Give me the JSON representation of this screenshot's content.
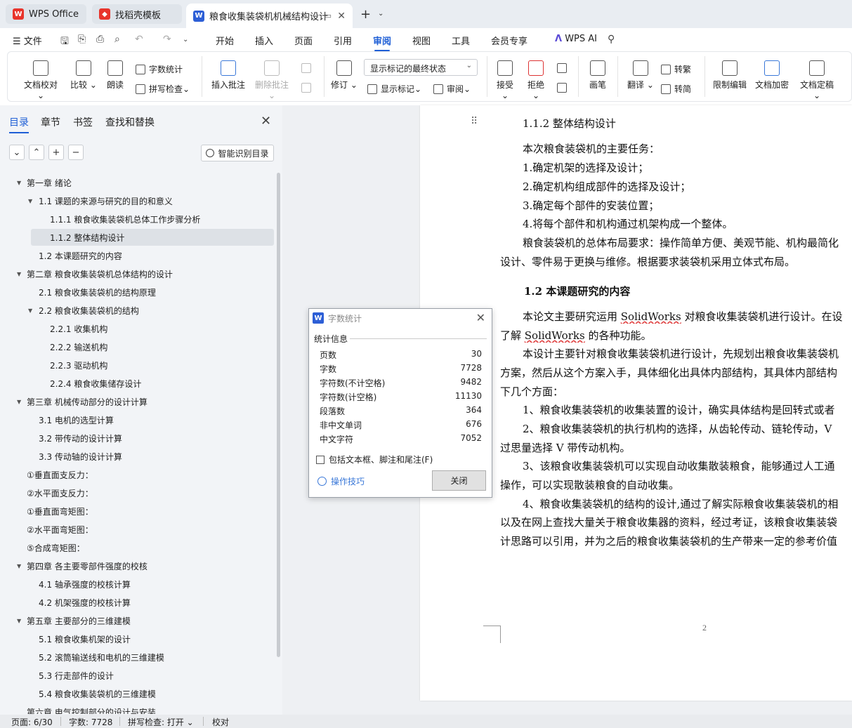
{
  "tabs": [
    {
      "label": "WPS Office",
      "icon": "wps-logo-icon"
    },
    {
      "label": "找稻壳模板",
      "icon": "docer-icon"
    },
    {
      "label": "粮食收集装袋机机械结构设计",
      "icon": "word-doc-icon"
    }
  ],
  "menu": {
    "file": "文件",
    "items": [
      "开始",
      "插入",
      "页面",
      "引用",
      "审阅",
      "视图",
      "工具",
      "会员专享"
    ],
    "active": "审阅",
    "ai": "WPS AI"
  },
  "ribbon": {
    "doc_proofread": "文档校对",
    "compare": "比较",
    "read_aloud": "朗读",
    "word_count": "字数统计",
    "spell_check": "拼写检查",
    "insert_comment": "插入批注",
    "delete_comment": "删除批注",
    "revise": "修订",
    "show_markup_state": "显示标记的最终状态",
    "show_markup": "显示标记",
    "review": "审阅",
    "accept": "接受",
    "reject": "拒绝",
    "pen": "画笔",
    "translate": "翻译",
    "to_traditional": "转繁",
    "to_simplified": "转简",
    "restrict_edit": "限制编辑",
    "encrypt": "文档加密",
    "finalize": "文档定稿"
  },
  "panel": {
    "tabs": [
      "目录",
      "章节",
      "书签",
      "查找和替换"
    ],
    "smart_toc": "智能识别目录",
    "toc": [
      {
        "text": "第一章  绪论",
        "level": 0,
        "toggle": true
      },
      {
        "text": "1.1  课题的来源与研究的目的和意义",
        "level": 1,
        "toggle": true
      },
      {
        "text": "1.1.1  粮食收集装袋机总体工作步骤分析",
        "level": 2,
        "toggle": false
      },
      {
        "text": "1.1.2  整体结构设计",
        "level": 2,
        "toggle": false,
        "selected": true
      },
      {
        "text": "1.2  本课题研究的内容",
        "level": 1,
        "toggle": false
      },
      {
        "text": "第二章  粮食收集装袋机总体结构的设计",
        "level": 0,
        "toggle": true
      },
      {
        "text": "2.1  粮食收集装袋机的结构原理",
        "level": 1,
        "toggle": false
      },
      {
        "text": "2.2  粮食收集装袋机的结构",
        "level": 1,
        "toggle": true
      },
      {
        "text": "2.2.1    收集机构",
        "level": 2,
        "toggle": false
      },
      {
        "text": "2.2.2    输送机构",
        "level": 2,
        "toggle": false
      },
      {
        "text": "2.2.3  驱动机构",
        "level": 2,
        "toggle": false
      },
      {
        "text": "2.2.4  粮食收集储存设计",
        "level": 2,
        "toggle": false
      },
      {
        "text": "第三章  机械传动部分的设计计算",
        "level": 0,
        "toggle": true
      },
      {
        "text": "3.1  电机的选型计算",
        "level": 1,
        "toggle": false
      },
      {
        "text": "3.2  带传动的设计计算",
        "level": 1,
        "toggle": false
      },
      {
        "text": "3.3  传动轴的设计计算",
        "level": 1,
        "toggle": false
      },
      {
        "text": "①垂直面支反力：",
        "level": -1,
        "toggle": false
      },
      {
        "text": "②水平面支反力：",
        "level": -1,
        "toggle": false
      },
      {
        "text": "①垂直面弯矩图：",
        "level": -1,
        "toggle": false
      },
      {
        "text": "②水平面弯矩图：",
        "level": -1,
        "toggle": false
      },
      {
        "text": "⑤合成弯矩图：",
        "level": -1,
        "toggle": false
      },
      {
        "text": "第四章  各主要零部件强度的校核",
        "level": 0,
        "toggle": true
      },
      {
        "text": "4.1  轴承强度的校核计算",
        "level": 1,
        "toggle": false
      },
      {
        "text": "4.2  机架强度的校核计算",
        "level": 1,
        "toggle": false
      },
      {
        "text": "第五章  主要部分的三维建模",
        "level": 0,
        "toggle": true
      },
      {
        "text": "5.1  粮食收集机架的设计",
        "level": 1,
        "toggle": false
      },
      {
        "text": "5.2  滚筒输送线和电机的三维建模",
        "level": 1,
        "toggle": false
      },
      {
        "text": "5.3  行走部件的设计",
        "level": 1,
        "toggle": false
      },
      {
        "text": "5.4  粮食收集装袋机的三维建模",
        "level": 1,
        "toggle": false
      },
      {
        "text": "第六章  电气控制部分的设计与安装",
        "level": 0,
        "toggle": false
      }
    ]
  },
  "document": {
    "lines": [
      {
        "text": "1.1.2  整体结构设计",
        "style": "h3"
      },
      {
        "text": "本次粮食装袋机的主要任务：",
        "style": "p"
      },
      {
        "text": "1.确定机架的选择及设计；",
        "style": "p"
      },
      {
        "text": "2.确定机构组成部件的选择及设计；",
        "style": "p"
      },
      {
        "text": "3.确定每个部件的安装位置；",
        "style": "p"
      },
      {
        "text": "4.将每个部件和机构通过机架构成一个整体。",
        "style": "p"
      },
      {
        "text": "粮食装袋机的总体布局要求：操作简单方便、美观节能、机构最简化",
        "style": "p"
      },
      {
        "text": "设计、零件易于更换与维修。根据要求装袋机采用立体式布局。",
        "style": "c"
      },
      {
        "text": "1.2  本课题研究的内容",
        "style": "h2"
      },
      {
        "text": "本论文主要研究运用 SolidWorks 对粮食收集装袋机进行设计。在设",
        "style": "p"
      },
      {
        "text": "了解 SolidWorks 的各种功能。",
        "style": "c"
      },
      {
        "text": "本设计主要针对粮食收集装袋机进行设计，先规划出粮食收集装袋机",
        "style": "p"
      },
      {
        "text": "方案，然后从这个方案入手，具体细化出具体内部结构，其具体内部结构",
        "style": "c"
      },
      {
        "text": "下几个方面：",
        "style": "c"
      },
      {
        "text": "1、粮食收集装袋机的收集装置的设计，确实具体结构是回转式或者",
        "style": "p"
      },
      {
        "text": "2、粮食收集装袋机的执行机构的选择，从齿轮传动、链轮传动，V",
        "style": "p"
      },
      {
        "text": "过思量选择 V 带传动机构。",
        "style": "c"
      },
      {
        "text": "3、该粮食收集装袋机可以实现自动收集散装粮食，能够通过人工通",
        "style": "p"
      },
      {
        "text": "操作，可以实现散装粮食的自动收集。",
        "style": "c"
      },
      {
        "text": "4、粮食收集装袋机的结构的设计,通过了解实际粮食收集装袋机的相",
        "style": "p"
      },
      {
        "text": "以及在网上查找大量关于粮食收集器的资料，经过考证，该粮食收集装袋",
        "style": "c"
      },
      {
        "text": "计思路可以引用，并为之后的粮食收集装袋机的生产带来一定的参考价值",
        "style": "c"
      }
    ],
    "page_number": "2"
  },
  "dialog": {
    "title": "字数统计",
    "section": "统计信息",
    "stats": [
      {
        "label": "页数",
        "value": "30"
      },
      {
        "label": "字数",
        "value": "7728"
      },
      {
        "label": "字符数(不计空格)",
        "value": "9482"
      },
      {
        "label": "字符数(计空格)",
        "value": "11130"
      },
      {
        "label": "段落数",
        "value": "364"
      },
      {
        "label": "非中文单词",
        "value": "676"
      },
      {
        "label": "中文字符",
        "value": "7052"
      }
    ],
    "checkbox": "包括文本框、脚注和尾注(F)",
    "tips": "操作技巧",
    "close": "关闭"
  },
  "status": {
    "page": "页面: 6/30",
    "words": "字数: 7728",
    "spell": "拼写检查: 打开",
    "proof": "校对"
  },
  "colors": {
    "accent": "#1f5fd6",
    "wps_red": "#e8342b",
    "panel_bg": "#f2f4f7",
    "doc_bg": "#eef0f3"
  }
}
